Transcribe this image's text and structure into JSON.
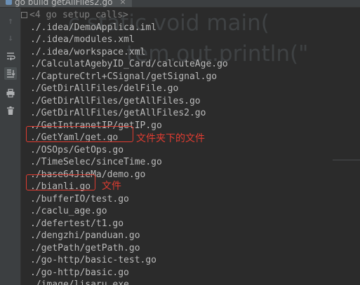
{
  "tab": {
    "title": "go build getAllFiles2.go"
  },
  "toolbar": {
    "icons": [
      "arrow-up-icon",
      "arrow-down-icon",
      "soft-wrap-icon",
      "scroll-to-end-icon",
      "print-icon",
      "trash-icon"
    ]
  },
  "background_code": {
    "line1": "c static void main(",
    "line2": "tem.out.println(\""
  },
  "console": {
    "header": "<4 go setup calls>",
    "lines": [
      "./.idea/DemoApplica.iml",
      "./.idea/modules.xml",
      "./.idea/workspace.xml",
      "./CalculatAgebyID_Card/calcuteAge.go",
      "./CaptureCtrl+CSignal/getSignal.go",
      "./GetDirAllFiles/delFile.go",
      "./GetDirAllFiles/getAllFiles.go",
      "./GetDirAllFiles/getAllFiles2.go",
      "./GetIntranetIP/getIP.go",
      "./GetYaml/get.go",
      "./OSOps/GetOps.go",
      "./TimeSelec/sinceTime.go",
      "./base64JieMa/demo.go",
      "./bianli.go",
      "./bufferIO/test.go",
      "./caclu_age.go",
      "./defertest/t1.go",
      "./dengzhi/panduan.go",
      "./getPath/getPath.go",
      "./go-http/basic-test.go",
      "./go-http/basic.go",
      "./image/lisaru.exe"
    ]
  },
  "annotations": {
    "note1": "文件夹下的文件",
    "note2": "文件"
  },
  "colors": {
    "background": "#2b2b2b",
    "text": "#bbbbbb",
    "annotation": "#e03c31"
  }
}
